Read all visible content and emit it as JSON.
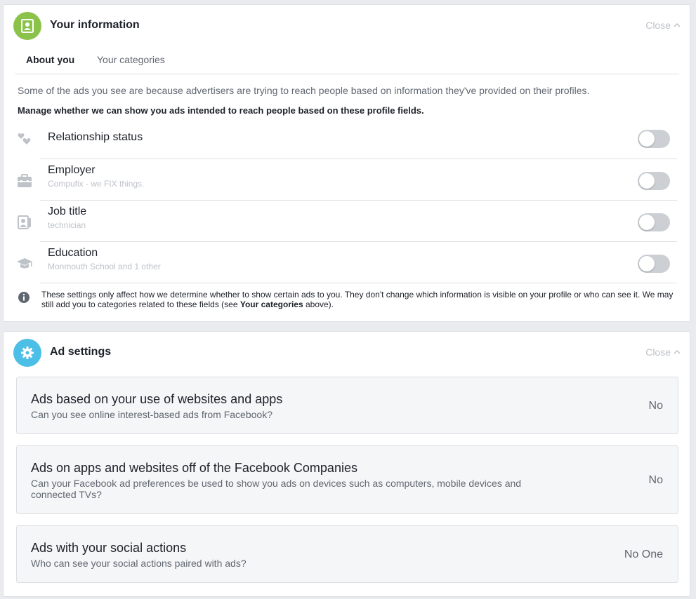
{
  "your_information": {
    "title": "Your information",
    "close_label": "Close",
    "icon_color": "#8bc34a",
    "tabs": [
      {
        "label": "About you",
        "active": true
      },
      {
        "label": "Your categories",
        "active": false
      }
    ],
    "intro": "Some of the ads you see are because advertisers are trying to reach people based on information they've provided on their profiles.",
    "manage_text": "Manage whether we can show you ads intended to reach people based on these profile fields.",
    "fields": [
      {
        "label": "Relationship status",
        "sub": "",
        "icon": "hearts-icon",
        "enabled": false
      },
      {
        "label": "Employer",
        "sub": "Compufix - we FIX things.",
        "icon": "briefcase-icon",
        "enabled": false
      },
      {
        "label": "Job title",
        "sub": "technician",
        "icon": "id-badge-icon",
        "enabled": false
      },
      {
        "label": "Education",
        "sub": "Monmouth School and 1 other",
        "icon": "graduation-cap-icon",
        "enabled": false
      }
    ],
    "footnote_part1": "These settings only affect how we determine whether to show certain ads to you. They don't change which information is visible on your profile or who can see it. We may still add you to categories related to these fields (see ",
    "footnote_bold": "Your categories",
    "footnote_part2": " above)."
  },
  "ad_settings": {
    "title": "Ad settings",
    "close_label": "Close",
    "icon_color": "#4cbfe6",
    "items": [
      {
        "title": "Ads based on your use of websites and apps",
        "desc": "Can you see online interest-based ads from Facebook?",
        "value": "No"
      },
      {
        "title": "Ads on apps and websites off of the Facebook Companies",
        "desc": "Can your Facebook ad preferences be used to show you ads on devices such as computers, mobile devices and connected TVs?",
        "value": "No"
      },
      {
        "title": "Ads with your social actions",
        "desc": "Who can see your social actions paired with ads?",
        "value": "No One"
      }
    ]
  }
}
